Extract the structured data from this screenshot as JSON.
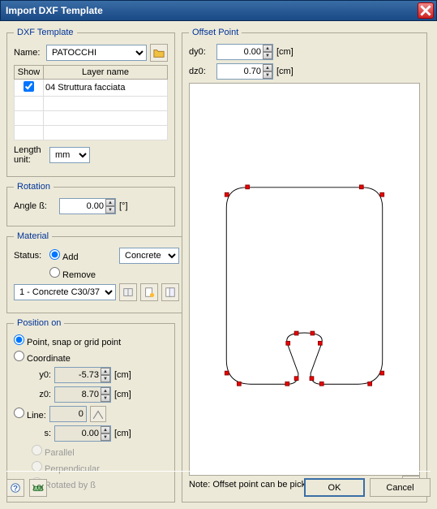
{
  "window": {
    "title": "Import DXF Template"
  },
  "dxf_template": {
    "legend": "DXF Template",
    "name_label": "Name:",
    "name_value": "PATOCCHI",
    "table": {
      "col_show": "Show",
      "col_layer": "Layer name",
      "rows": [
        {
          "checked": true,
          "name": "04 Struttura facciata"
        }
      ]
    },
    "length_unit_label": "Length\nunit:",
    "length_unit_value": "mm"
  },
  "rotation": {
    "legend": "Rotation",
    "angle_label": "Angle ß:",
    "angle_value": "0.00",
    "angle_unit": "[°]"
  },
  "material": {
    "legend": "Material",
    "status_label": "Status:",
    "add_label": "Add",
    "remove_label": "Remove",
    "material_type": "Concrete",
    "material_selected": "1 - Concrete C30/37"
  },
  "position": {
    "legend": "Position on",
    "point_label": "Point, snap or grid point",
    "coord_label": "Coordinate",
    "y0_label": "y0:",
    "y0_value": "-5.73",
    "z0_label": "z0:",
    "z0_value": "8.70",
    "unit_cm": "[cm]",
    "line_label": "Line:",
    "line_value": "0",
    "s_label": "s:",
    "s_value": "0.00",
    "parallel_label": "Parallel",
    "perp_label": "Perpendicular",
    "rotated_label": "Rotated by ß"
  },
  "offset": {
    "legend": "Offset Point",
    "dy0_label": "dy0:",
    "dy0_value": "0.00",
    "dz0_label": "dz0:",
    "dz0_value": "0.70",
    "unit_cm": "[cm]",
    "note": "Note: Offset point can be picked by mouse!"
  },
  "buttons": {
    "ok": "OK",
    "cancel": "Cancel"
  }
}
